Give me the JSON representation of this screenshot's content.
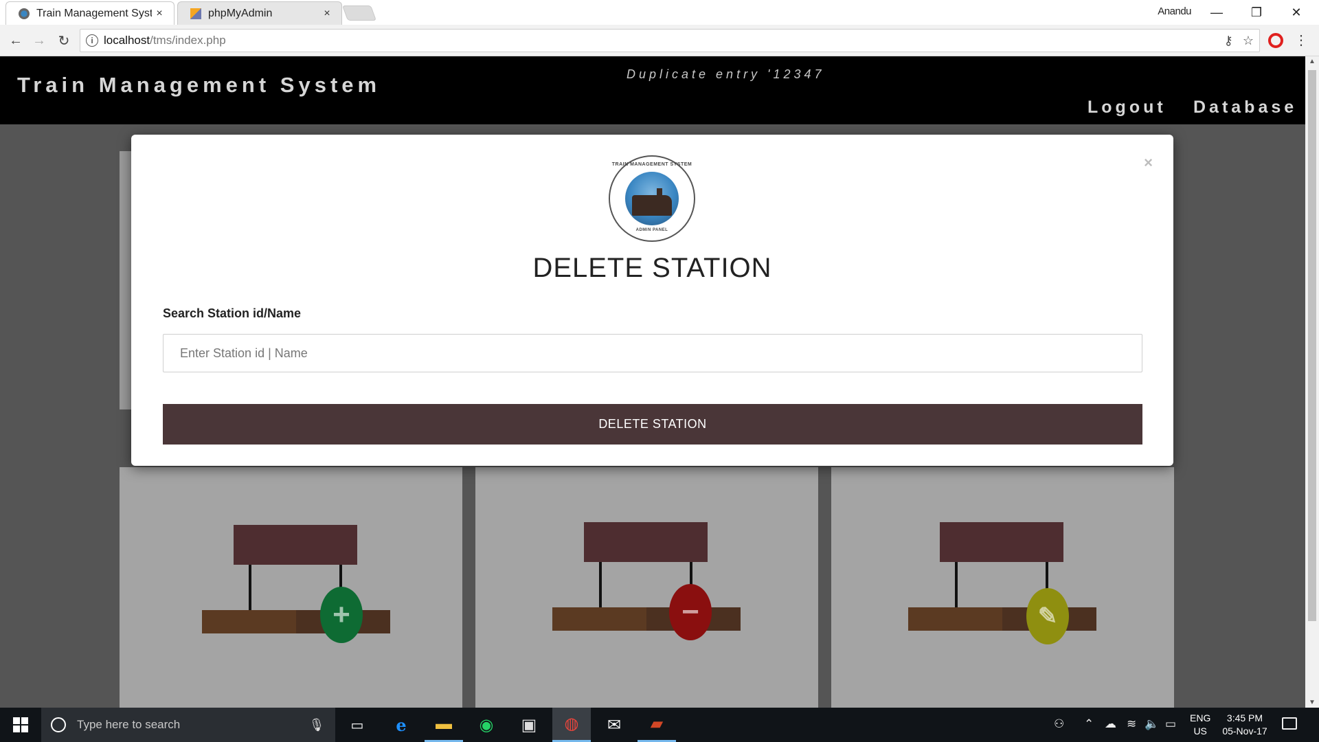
{
  "browser": {
    "tabs": [
      {
        "title": "Train Management Syste",
        "active": true
      },
      {
        "title": "phpMyAdmin",
        "active": false
      }
    ],
    "tab_close_glyph": "×",
    "window_user": "Anandu",
    "url_host": "localhost",
    "url_path": "/tms/index.php"
  },
  "header": {
    "site_title": "Train Management System",
    "flash_message": "Duplicate entry '12347",
    "nav": {
      "logout": "Logout",
      "database": "Database"
    }
  },
  "modal": {
    "close_glyph": "×",
    "logo_top_text": "TRAIN MANAGEMENT SYSTEM",
    "logo_bottom_text": "ADMIN PANEL",
    "title": "DELETE STATION",
    "search_label": "Search Station id/Name",
    "search_placeholder": "Enter Station id | Name",
    "search_value": "",
    "submit_label": "DELETE STATION"
  },
  "cards": [
    {
      "icon": "plus-icon",
      "glyph": "+",
      "color": "#0e6b33"
    },
    {
      "icon": "minus-icon",
      "glyph": "−",
      "color": "#8a0f0f"
    },
    {
      "icon": "pencil-icon",
      "glyph": "✎",
      "color": "#8f8f10"
    }
  ],
  "taskbar": {
    "search_placeholder": "Type here to search",
    "lang_line1": "ENG",
    "lang_line2": "US",
    "time": "3:45 PM",
    "date": "05-Nov-17"
  },
  "colors": {
    "header_bg": "#000000",
    "modal_button_bg": "#4a3638",
    "overlay_bg": "#555555"
  }
}
